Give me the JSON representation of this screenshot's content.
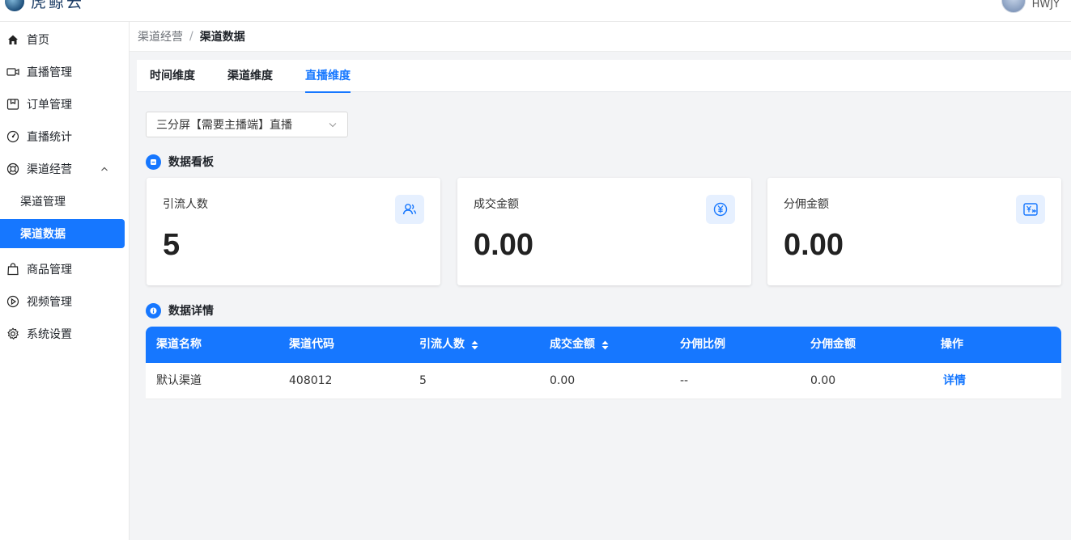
{
  "header": {
    "logo_text": "虎鲸云",
    "user_name": "HWJY"
  },
  "sidebar": {
    "items": [
      {
        "label": "首页",
        "icon": "home-icon"
      },
      {
        "label": "直播管理",
        "icon": "video-camera-icon"
      },
      {
        "label": "订单管理",
        "icon": "order-box-icon"
      },
      {
        "label": "直播统计",
        "icon": "gauge-icon"
      },
      {
        "label": "渠道经营",
        "icon": "lifebuoy-icon"
      },
      {
        "label": "商品管理",
        "icon": "shopping-bag-icon"
      },
      {
        "label": "视频管理",
        "icon": "play-circle-icon"
      },
      {
        "label": "系统设置",
        "icon": "gear-icon"
      }
    ],
    "sub_items": [
      {
        "label": "渠道管理"
      },
      {
        "label": "渠道数据"
      }
    ]
  },
  "breadcrumb": {
    "parent": "渠道经营",
    "separator": "/",
    "current": "渠道数据"
  },
  "tabs": [
    {
      "label": "时间维度"
    },
    {
      "label": "渠道维度"
    },
    {
      "label": "直播维度"
    }
  ],
  "live_select": {
    "value": "三分屏【需要主播端】直播"
  },
  "dashboard": {
    "title": "数据看板",
    "cards": [
      {
        "label": "引流人数",
        "value": "5",
        "icon": "users-icon"
      },
      {
        "label": "成交金额",
        "value": "0.00",
        "icon": "yuan-coin-icon"
      },
      {
        "label": "分佣金额",
        "value": "0.00",
        "icon": "commission-icon"
      }
    ]
  },
  "details": {
    "title": "数据详情",
    "columns": [
      "渠道名称",
      "渠道代码",
      "引流人数",
      "成交金额",
      "分佣比例",
      "分佣金额",
      "操作"
    ],
    "rows": [
      {
        "name": "默认渠道",
        "code": "408012",
        "visitors": "5",
        "amount": "0.00",
        "ratio": "--",
        "commission": "0.00",
        "action": "详情"
      }
    ]
  },
  "colors": {
    "primary": "#1677ff",
    "icon_bg": "#e6f0ff",
    "page_bg": "#f3f4f6"
  }
}
